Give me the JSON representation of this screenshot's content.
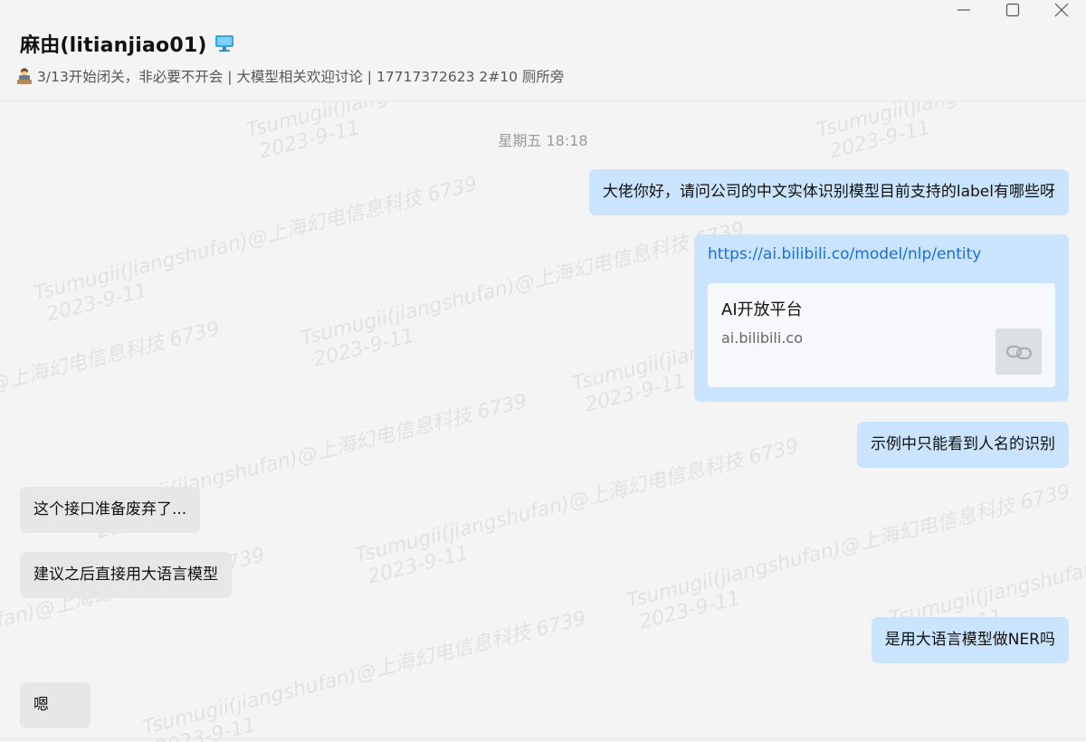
{
  "window": {
    "minimize_icon": "minimize-icon",
    "maximize_icon": "maximize-icon",
    "close_icon": "close-icon"
  },
  "header": {
    "title": "麻由(litianjiao01)",
    "device_icon": "desktop-monitor-icon",
    "status_icon": "person-at-desk-emoji",
    "status_text": "3/13开始闭关，非必要不开会 | 大模型相关欢迎讨论 | 17717372623 2#10 厕所旁"
  },
  "watermark": {
    "line1": "Tsumugii(jiangshufan)@上海幻电信息科技 6739",
    "line2": "2023-9-11"
  },
  "chat": {
    "time_separator": "星期五 18:18",
    "messages": [
      {
        "side": "me",
        "type": "text",
        "text": "大佬你好，请问公司的中文实体识别模型目前支持的label有哪些呀"
      },
      {
        "side": "me",
        "type": "link",
        "url": "https://ai.bilibili.co/model/nlp/entity",
        "card_title": "AI开放平台",
        "card_domain": "ai.bilibili.co",
        "card_icon": "link-chain-icon"
      },
      {
        "side": "me",
        "type": "text",
        "text": "示例中只能看到人名的识别"
      },
      {
        "side": "other",
        "type": "text",
        "text": "这个接口准备废弃了..."
      },
      {
        "side": "other",
        "type": "text",
        "text": "建议之后直接用大语言模型"
      },
      {
        "side": "me",
        "type": "text",
        "text": "是用大语言模型做NER吗"
      },
      {
        "side": "other",
        "type": "text",
        "text": "嗯"
      }
    ]
  },
  "colors": {
    "background": "#f4f4f4",
    "my_bubble": "#c9e4fc",
    "other_bubble": "#e7e7e7",
    "link": "#1a6ed8",
    "time_text": "#9b9b9b"
  }
}
